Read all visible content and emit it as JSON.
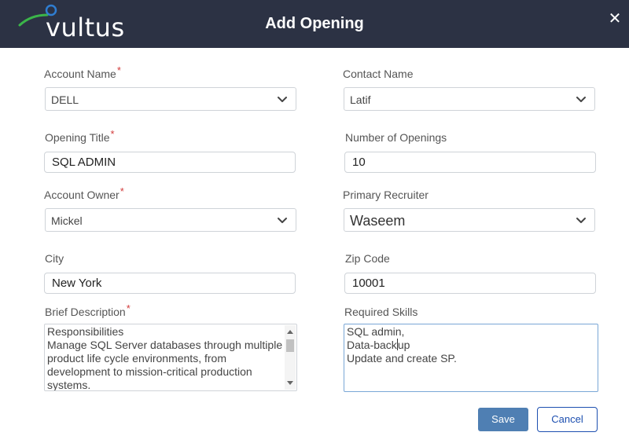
{
  "header": {
    "logo_text": "vultus",
    "title": "Add Opening",
    "close_glyph": "✕",
    "logo_colors": {
      "swoosh": "#3bb54a",
      "ring": "#2f7dd1"
    }
  },
  "form": {
    "account_name": {
      "label": "Account Name",
      "value": "DELL",
      "required_mark": "*"
    },
    "contact_name": {
      "label": "Contact Name",
      "value": "Latif"
    },
    "opening_title": {
      "label": "Opening Title",
      "value": "SQL ADMIN",
      "required_mark": "*"
    },
    "number_of_openings": {
      "label": "Number of Openings",
      "value": "10"
    },
    "account_owner": {
      "label": "Account Owner",
      "value": "Mickel",
      "required_mark": "*"
    },
    "primary_recruiter": {
      "label": "Primary Recruiter",
      "value": "Waseem"
    },
    "city": {
      "label": "City",
      "value": "New York"
    },
    "zip_code": {
      "label": "Zip Code",
      "value": "10001"
    },
    "brief_description": {
      "label": "Brief Description",
      "required_mark": "*",
      "lines": [
        "Responsibilities",
        "Manage SQL Server databases through multiple",
        "product life cycle environments, from",
        "development to mission-critical production",
        "systems."
      ]
    },
    "required_skills": {
      "label": "Required Skills",
      "line1": "SQL admin,",
      "line2_before_caret": "Data-back",
      "line2_after_caret": "up",
      "line3": "Update and create SP."
    }
  },
  "actions": {
    "save_label": "Save",
    "cancel_label": "Cancel"
  },
  "icons": {
    "dropdown": "chevron-down-icon",
    "close": "close-icon"
  },
  "colors": {
    "header_bg": "#2c3244",
    "save_bg": "#4f7fb3",
    "cancel_border": "#1d4fb0",
    "required": "#d23b3b"
  }
}
